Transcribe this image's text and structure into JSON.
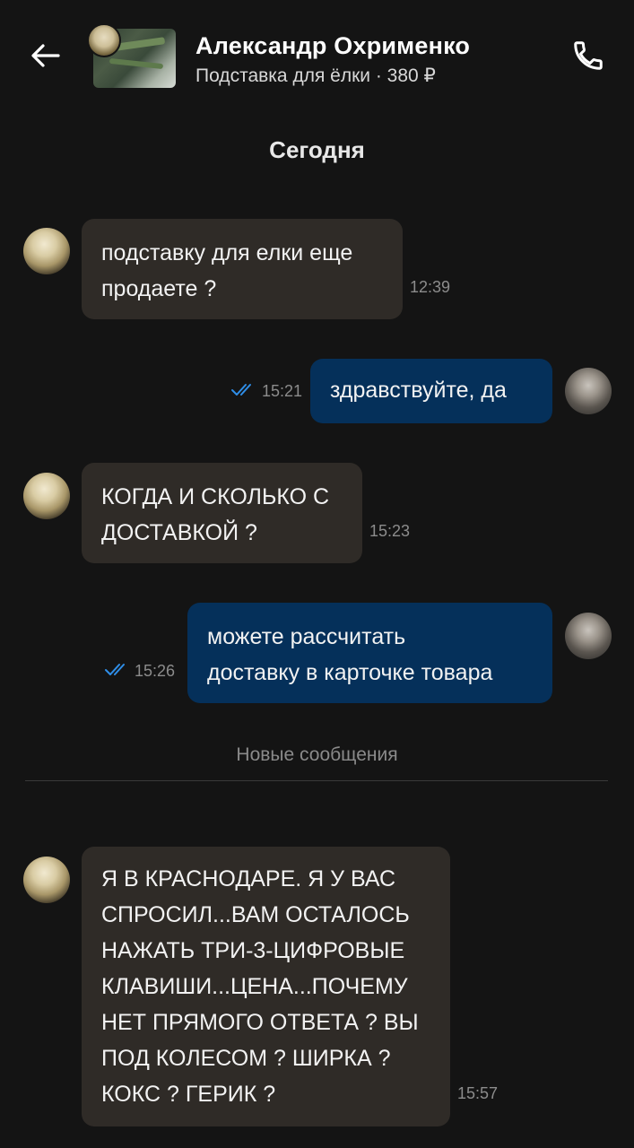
{
  "header": {
    "name": "Александр Охрименко",
    "listing": "Подставка для ёлки · 380 ₽",
    "back_icon": "arrow-left-icon",
    "call_icon": "phone-icon"
  },
  "date_separator": "Сегодня",
  "new_messages_label": "Новые сообщения",
  "messages": [
    {
      "direction": "in",
      "text_lines": [
        "подставку для елки еще",
        "продаете ?"
      ],
      "time": "12:39"
    },
    {
      "direction": "out",
      "text_lines": [
        "здравствуйте, да"
      ],
      "time": "15:21",
      "read": true
    },
    {
      "direction": "in",
      "text_lines": [
        "КОГДА И СКОЛЬКО С",
        "ДОСТАВКОЙ ?"
      ],
      "time": "15:23"
    },
    {
      "direction": "out",
      "text_lines": [
        "можете рассчитать",
        "доставку в карточке товара"
      ],
      "time": "15:26",
      "read": true
    },
    {
      "direction": "in",
      "text_lines": [
        "Я В КРАСНОДАРЕ. Я У ВАС",
        "СПРОСИЛ...ВАМ ОСТАЛОСЬ",
        "НАЖАТЬ ТРИ-3-ЦИФРОВЫЕ",
        "КЛАВИШИ...ЦЕНА...ПОЧЕМУ",
        "НЕТ ПРЯМОГО ОТВЕТА ? ВЫ",
        "ПОД КОЛЕСОМ ? ШИРКА ?",
        "КОКС ? ГЕРИК ?"
      ],
      "time": "15:57"
    }
  ],
  "colors": {
    "background": "#141414",
    "incoming_bubble": "#2f2b27",
    "outgoing_bubble": "#05305a",
    "read_check": "#2f8ee8"
  }
}
